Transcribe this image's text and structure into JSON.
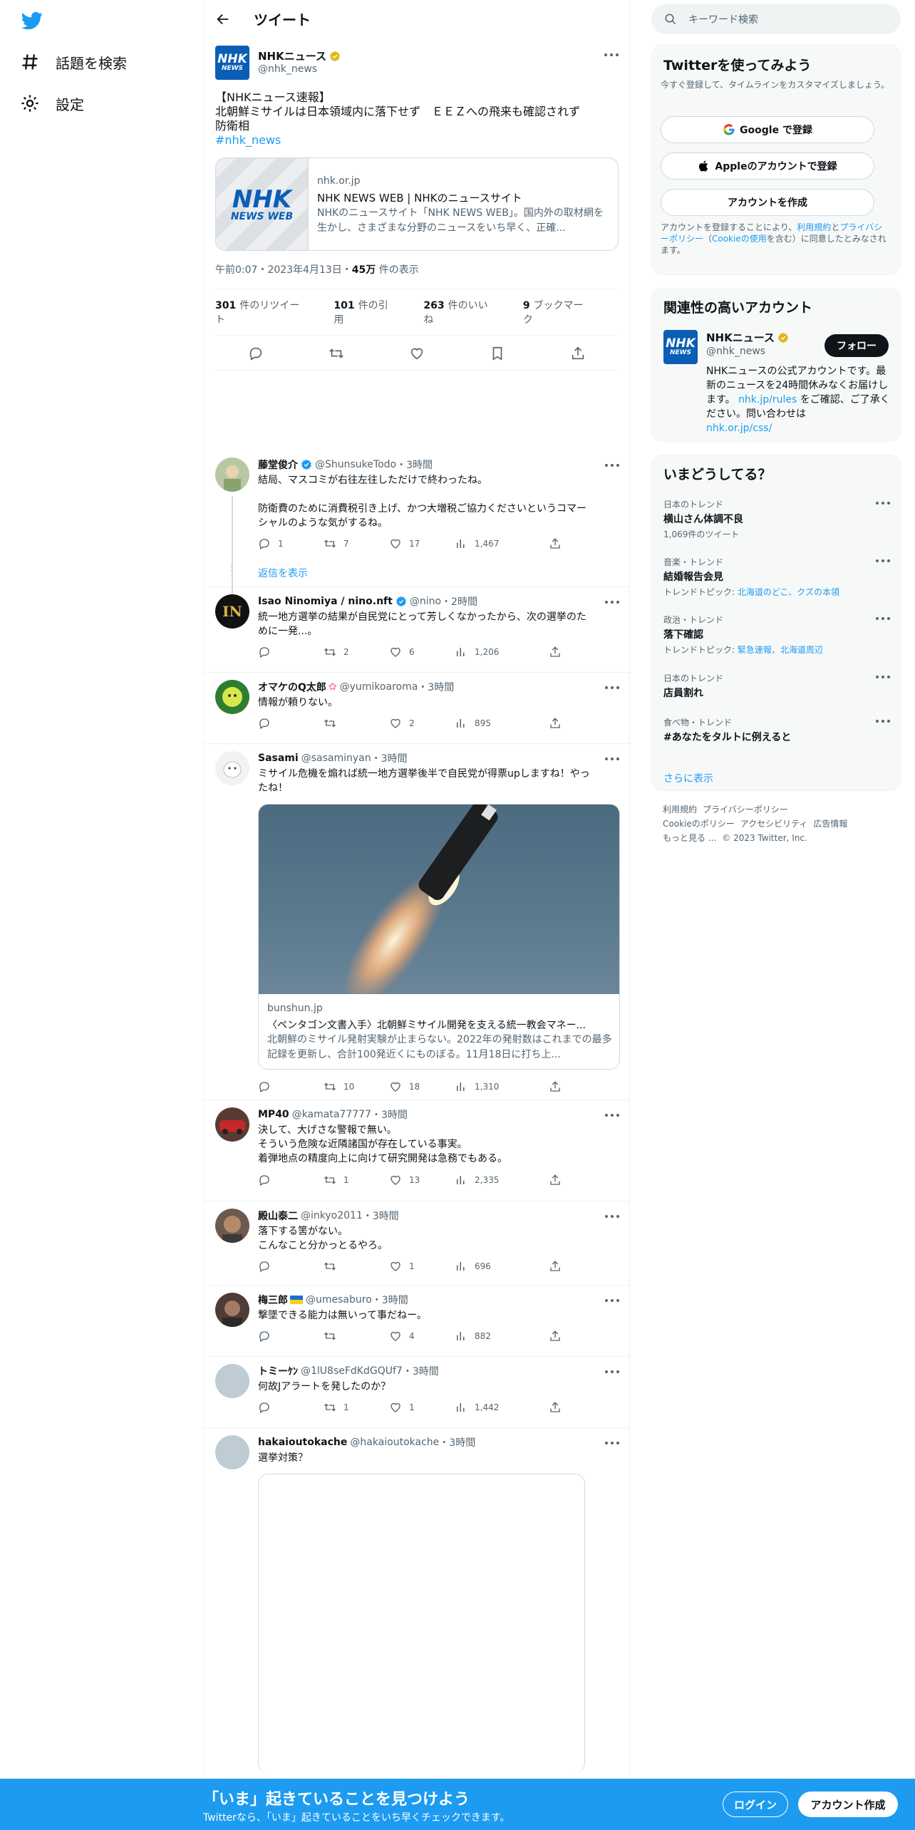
{
  "nav": {
    "explore": "話題を検索",
    "settings": "設定"
  },
  "header": {
    "title": "ツイート"
  },
  "main_tweet": {
    "avatar_text": "NHK",
    "avatar_sub": "NEWS",
    "name": "NHKニュース",
    "handle": "@nhk_news",
    "lines": [
      "【NHKニュース速報】",
      "北朝鮮ミサイルは日本領域内に落下せず　ＥＥＺへの飛来も確認されず",
      "防衛相"
    ],
    "hashtag": "#nhk_news",
    "card": {
      "img_a": "NHK",
      "img_b": "NEWS WEB",
      "domain": "nhk.or.jp",
      "title": "NHK NEWS WEB | NHKのニュースサイト",
      "desc": "NHKのニュースサイト「NHK NEWS WEB」。国内外の取材網を生かし、さまざまな分野のニュースをいち早く、正確..."
    },
    "time": "午前0:07・2023年4月13日・",
    "views": "45万",
    "views_label": "件の表示",
    "stats": [
      {
        "num": "301",
        "label": "件のリツイート"
      },
      {
        "num": "101",
        "label": "件の引用"
      },
      {
        "num": "263",
        "label": "件のいいね"
      },
      {
        "num": "9",
        "label": "ブックマーク"
      }
    ]
  },
  "replies": [
    {
      "name": "藤堂俊介",
      "handle": "@ShunsukeTodo",
      "time": "・3時間",
      "lines": [
        "結局、マスコミが右往左往しただけで終わったね。",
        "",
        "防衛費のために消費税引き上げ、かつ大増税ご協力くださいというコマー",
        "シャルのような気がするね。"
      ],
      "replies": "1",
      "retweets": "7",
      "likes": "17",
      "views": "1,467",
      "show_replies": "返信を表示"
    },
    {
      "name": "Isao Ninomiya / nino.nft",
      "handle": "@nino",
      "time": "・2時間",
      "lines": [
        "統一地方選挙の結果が自民党にとって芳しくなかったから、次の選挙のた",
        "めに一発...。"
      ],
      "replies": "",
      "retweets": "2",
      "likes": "6",
      "views": "1,206"
    },
    {
      "name": "オマケのQ太郎",
      "handle": "@yumikoaroma",
      "time": "・3時間",
      "lines": [
        "情報が頼りない。"
      ],
      "replies": "",
      "retweets": "",
      "likes": "2",
      "views": "895"
    },
    {
      "name": "Sasami",
      "handle": "@sasaminyan",
      "time": "・3時間",
      "lines": [
        "ミサイル危機を煽れば統一地方選挙後半で自民党が得票upしますね！やっ",
        "たね！"
      ],
      "card": {
        "domain": "bunshun.jp",
        "title": "〈ペンタゴン文書入手〉北朝鮮ミサイル開発を支える統一教会マネー...",
        "desc": "北朝鮮のミサイル発射実験が止まらない。2022年の発射数はこれまでの最多記録を更新し、合計100発近くにものぼる。11月18日に打ち上..."
      },
      "replies": "",
      "retweets": "10",
      "likes": "18",
      "views": "1,310"
    },
    {
      "name": "MP40",
      "handle": "@kamata77777",
      "time": "・3時間",
      "lines": [
        "決して、大げさな警報で無い。",
        "そういう危険な近隣諸国が存在している事実。",
        "着弾地点の精度向上に向けて研究開発は急務でもある。"
      ],
      "replies": "",
      "retweets": "1",
      "likes": "13",
      "views": "2,335"
    },
    {
      "name": "殿山泰二",
      "handle": "@inkyo2011",
      "time": "・3時間",
      "lines": [
        "落下する筈がない。",
        "こんなこと分かっとるやろ。"
      ],
      "replies": "",
      "retweets": "",
      "likes": "1",
      "views": "696"
    },
    {
      "name": "梅三郎",
      "handle": "@umesaburo",
      "time": "・3時間",
      "lines": [
        "撃墜できる能力は無いって事だねー。"
      ],
      "replies": "",
      "retweets": "",
      "likes": "4",
      "views": "882"
    },
    {
      "name": "トミーｹﾝ",
      "handle": "@1lU8seFdKdGQUf7",
      "time": "・3時間",
      "lines": [
        "何故Jアラートを発したのか？"
      ],
      "replies": "",
      "retweets": "1",
      "likes": "1",
      "views": "1,442"
    },
    {
      "name": "hakaioutokache",
      "handle": "@hakaioutokache",
      "time": "・3時間",
      "lines": [
        "選挙対策？"
      ]
    }
  ],
  "right": {
    "search_placeholder": "キーワード検索",
    "signup": {
      "title": "Twitterを使ってみよう",
      "sub": "今すぐ登録して、タイムラインをカスタマイズしましょう。",
      "google": "Google で登録",
      "apple": "Appleのアカウントで登録",
      "create": "アカウントを作成",
      "legal_1": "アカウントを登録することにより、",
      "legal_terms": "利用規約",
      "legal_2": "と",
      "legal_privacy": "プライバシーポリシー",
      "legal_3": "（",
      "legal_cookie": "Cookieの使用",
      "legal_4": "を含む）に同意したとみなされます。"
    },
    "related": {
      "title": "関連性の高いアカウント",
      "avatar_text": "NHK",
      "avatar_sub": "NEWS",
      "name": "NHKニュース",
      "handle": "@nhk_news",
      "follow": "フォロー",
      "bio_1": "NHKニュースの公式アカウントです。最新のニュースを24時間休みなくお届けします。",
      "bio_link1": "nhk.jp/rules",
      "bio_2": "をご確認、ご了承ください。問い合わせは",
      "bio_link2": "nhk.or.jp/css/"
    },
    "trends": {
      "title": "いまどうしてる？",
      "items": [
        {
          "cat": "日本のトレンド",
          "title": "横山さん体調不良",
          "sub": "1,069件のツイート"
        },
        {
          "cat": "音楽・トレンド",
          "title": "結婚報告会見",
          "sub_prefix": "トレンドトピック: ",
          "sub_links": "北海道のどこ、クズの本領"
        },
        {
          "cat": "政治・トレンド",
          "title": "落下確認",
          "sub_prefix": "トレンドトピック: ",
          "sub_links": "緊急速報、北海道周辺"
        },
        {
          "cat": "日本のトレンド",
          "title": "店員割れ"
        },
        {
          "cat": "食べ物・トレンド",
          "title": "#あなたをタルトに例えると"
        }
      ],
      "more": "さらに表示"
    },
    "footer": {
      "links": [
        "利用規約",
        "プライバシーポリシー",
        "Cookieのポリシー",
        "アクセシビリティ",
        "広告情報",
        "もっと見る ..."
      ],
      "copyright": "© 2023 Twitter, Inc."
    }
  },
  "bottom_bar": {
    "title": "「いま」起きていることを見つけよう",
    "sub": "Twitterなら、「いま」起きていることをいち早くチェックできます。",
    "login": "ログイン",
    "signup": "アカウント作成"
  }
}
